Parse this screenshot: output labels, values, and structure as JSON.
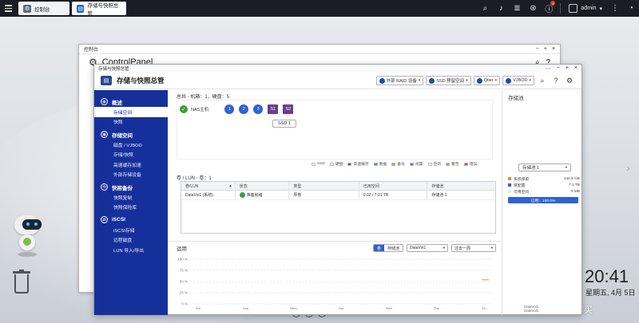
{
  "taskbar": {
    "tab1_label": "控制台",
    "tab2_label": "存储与快照总管",
    "user": "admin",
    "notif_count": "1"
  },
  "desktop": {
    "clock": "20:41",
    "date": "星期五, 4月 5日",
    "watermark": "值 · 什么值得买"
  },
  "control_panel": {
    "window_title": "控制台",
    "heading": "ControlPanel"
  },
  "storage": {
    "window_title": "存储与快照总管",
    "app_name": "存储与快照总管",
    "toolbar": {
      "external_raid": "外部 RAID 设备",
      "ssd_profile": "SSD 预留空间",
      "qtier": "Qtier",
      "vjbod": "VJBOD"
    },
    "sidebar": {
      "overview": "概述",
      "overview_items": [
        "存储空间",
        "快照"
      ],
      "storage_space": "存储空间",
      "storage_items": [
        "磁盘 / VJBOD",
        "存储/快照",
        "高速缓存加速",
        "外部存储设备"
      ],
      "snapshot_backup": "快照备份",
      "snapshot_items": [
        "快照复制",
        "快照保险库"
      ],
      "iscsi": "iSCSI",
      "iscsi_items": [
        "iSCSI存储",
        "远程磁盘",
        "LUN 导入/导出"
      ]
    },
    "summary": {
      "header": "总共 - 机箱：1，硬盘：5",
      "nas_label": "NAS主机",
      "disks": [
        "1",
        "2",
        "3"
      ],
      "ssd_slots": [
        "S1",
        "S2"
      ],
      "ssd_pill": "SSD 1"
    },
    "legend": [
      {
        "label": "SSD",
        "color": "#ffffff"
      },
      {
        "label": "硬盘",
        "color": "#ffffff"
      },
      {
        "label": "高速缓存",
        "color": "#2f62d3"
      },
      {
        "label": "数据",
        "color": "#2faa4a"
      },
      {
        "label": "备份",
        "color": "#e0a200"
      },
      {
        "label": "闲置",
        "color": "#4a7bd6"
      },
      {
        "label": "空的",
        "color": "#ffffff"
      },
      {
        "label": "警告",
        "color": "#f08a24"
      },
      {
        "label": "错误",
        "color": "#e63b2e"
      }
    ],
    "volumes": {
      "title": "卷 / LUN - 卷：1",
      "columns": [
        "卷/LUN",
        "状态",
        "类型",
        "已用空间",
        "存储池"
      ],
      "rows": [
        {
          "name": "DataVol1 (系统)",
          "status": "准备就绪",
          "type": "厚卷",
          "used": "0.02 / 7.01 TB",
          "pool": "存储池 1"
        }
      ]
    },
    "usage": {
      "title": "运用",
      "toggle_volume": "卷",
      "toggle_pool": "存储池",
      "volume_select": "DataVol1",
      "range_select": "过去一周",
      "side_labels": [
        "DataVol1",
        "DataVol1"
      ]
    },
    "pool_panel": {
      "title": "存储池",
      "pool_select": "存储池 1",
      "rows": [
        {
          "label": "系统保留",
          "value": "140.9 GB",
          "color": "#f08a24"
        },
        {
          "label": "厚配置",
          "value": "7.1 TB",
          "color": "#2f62d3"
        },
        {
          "label": "可用空间",
          "value": "0 MB",
          "color": "#e5e7ec"
        }
      ],
      "used_label": "已用：100.0%",
      "used_fraction": 1.0
    }
  },
  "chart_data": {
    "type": "line",
    "x": [
      "Sat",
      "Sun",
      "Mon",
      "Tue",
      "Wed",
      "Thu",
      "Fri"
    ],
    "yticks": [
      "100 %",
      "75 %",
      "50 %",
      "25 %",
      "0 %"
    ],
    "ylim": [
      0,
      100
    ],
    "grid": true,
    "series": [
      {
        "values": [
          null,
          null,
          null,
          null,
          null,
          null,
          0.3
        ],
        "color": "#f08a24"
      }
    ]
  }
}
